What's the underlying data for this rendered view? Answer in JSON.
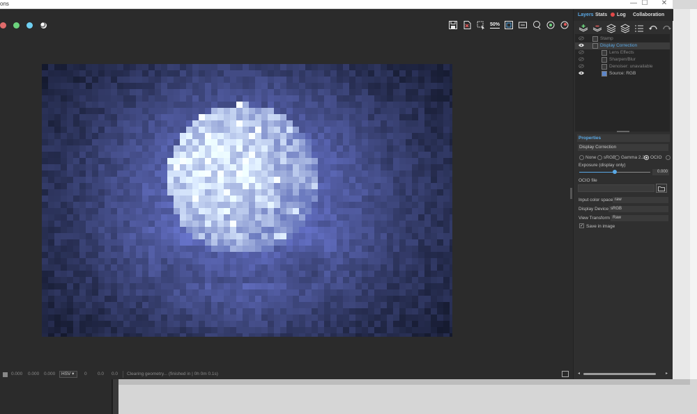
{
  "window": {
    "menu_fragment": "ons",
    "controls": [
      "minimize",
      "maximize",
      "close"
    ]
  },
  "toolbar": {
    "left_buttons": [
      "red-circle",
      "green-circle",
      "cyan-circle",
      "ball-icon"
    ],
    "zoom_label": "50%",
    "icons": [
      "save-icon",
      "export-icon",
      "crop-icon",
      "zoom-icon",
      "frame-icon",
      "tag-icon",
      "lasso-icon",
      "mask-icon",
      "teapot-icon"
    ]
  },
  "tabs": [
    {
      "label": "Layers",
      "active": true
    },
    {
      "label": "Stats",
      "active": false
    },
    {
      "label": "Log",
      "active": false
    },
    {
      "label": "Collaboration",
      "active": false
    }
  ],
  "layers": [
    {
      "name": "Stamp",
      "visible": false,
      "selected": false,
      "indent": 0
    },
    {
      "name": "Display Correction",
      "visible": true,
      "selected": true,
      "indent": 0
    },
    {
      "name": "Lens Effects",
      "visible": false,
      "selected": false,
      "indent": 1
    },
    {
      "name": "Sharpen/Blur",
      "visible": false,
      "selected": false,
      "indent": 1
    },
    {
      "name": "Denoiser: unavailable",
      "visible": false,
      "selected": false,
      "indent": 1
    },
    {
      "name": "Source: RGB",
      "visible": true,
      "selected": false,
      "indent": 1
    }
  ],
  "properties": {
    "header": "Properties",
    "layer_name": "Display Correction",
    "modes": [
      "None",
      "sRGB",
      "Gamma 2.2",
      "OCIO"
    ],
    "selected_mode": "OCIO",
    "exposure_label": "Exposure (display only)",
    "exposure_value": "0.000",
    "exposure_fraction": 0.5,
    "ocio_file_label": "OCIO file",
    "ocio_file_value": "",
    "input_color_space_label": "Input color space",
    "input_color_space_value": "raw",
    "display_device_label": "Display Device",
    "display_device_value": "sRGB",
    "view_transform_label": "View Transform",
    "view_transform_value": "Raw",
    "save_in_image_label": "Save in image",
    "save_in_image_checked": true
  },
  "status": {
    "values": [
      "0.000",
      "0.000",
      "0.000"
    ],
    "color_mode": "HSV",
    "coords": [
      "0",
      "0.0",
      "0.0"
    ],
    "message": "Clearing geometry... (finished in | 0h 0m 0.1s)"
  }
}
